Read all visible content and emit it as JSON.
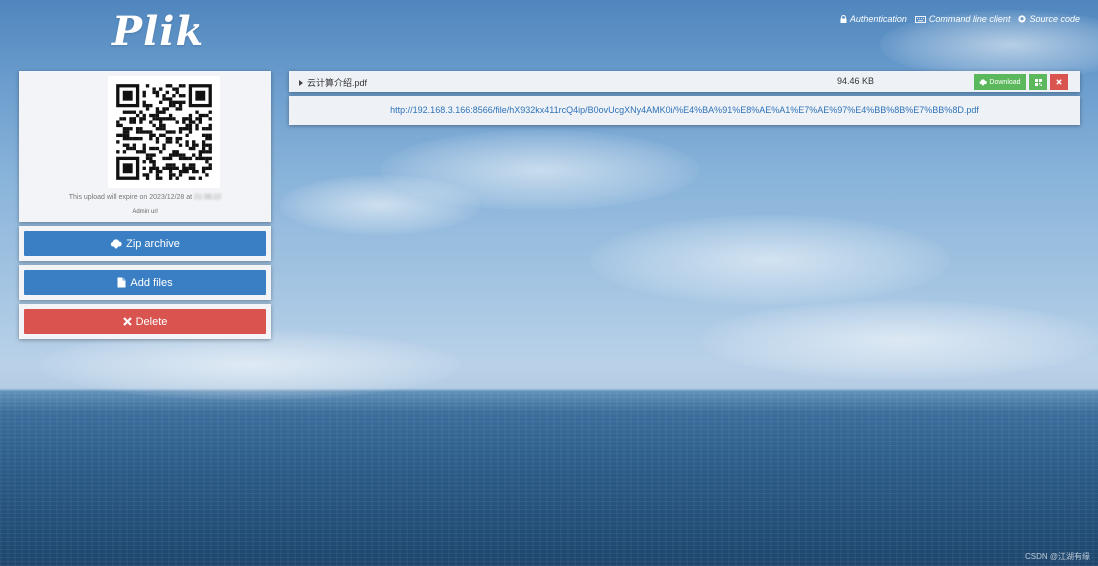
{
  "app": {
    "logo": "Plik"
  },
  "top_nav": [
    {
      "label": "Authentication",
      "icon": "lock-icon"
    },
    {
      "label": "Command line client",
      "icon": "keyboard-icon"
    },
    {
      "label": "Source code",
      "icon": "github-icon"
    }
  ],
  "upload": {
    "expire_text": "This upload will expire on 2023/12/28 at",
    "expire_time": "21:38:22",
    "admin_url_label": "Admin url"
  },
  "actions": {
    "zip_label": "Zip archive",
    "add_label": "Add files",
    "delete_label": "Delete"
  },
  "file": {
    "name": "云计算介绍.pdf",
    "size": "94.46 KB",
    "download_label": "Download",
    "url": "http://192.168.3.166:8566/file/hX932kx411rcQ4ip/B0ovUcgXNy4AMK0i/%E4%BA%91%E8%AE%A1%E7%AE%97%E4%BB%8B%E7%BB%8D.pdf"
  },
  "footer": {
    "watermark": "CSDN @江湖有缘"
  },
  "colors": {
    "primary": "#3a7fc4",
    "danger": "#d9534f",
    "success": "#5cb85c",
    "link": "#2e72b8"
  }
}
